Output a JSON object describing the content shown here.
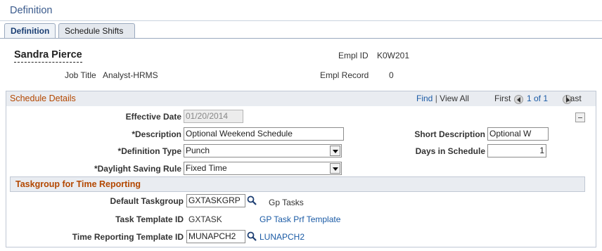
{
  "page": {
    "title": "Definition"
  },
  "tabs": [
    {
      "label": "Definition",
      "active": true
    },
    {
      "label": "Schedule Shifts",
      "active": false
    }
  ],
  "employee": {
    "name": "Sandra Pierce",
    "empl_id_label": "Empl ID",
    "empl_id": "K0W201",
    "job_title_label": "Job Title",
    "job_title": "Analyst-HRMS",
    "empl_record_label": "Empl Record",
    "empl_record": "0"
  },
  "schedule_details": {
    "title": "Schedule Details",
    "find_label": "Find",
    "separator": "|",
    "view_all_label": "View All",
    "first_label": "First",
    "counter": "1 of 1",
    "last_label": "Last",
    "fields": {
      "effective_date": {
        "label": "Effective Date",
        "value": "01/20/2014"
      },
      "description": {
        "label": "*Description",
        "value": "Optional Weekend Schedule"
      },
      "short_description": {
        "label": "Short Description",
        "value": "Optional W"
      },
      "definition_type": {
        "label": "*Definition Type",
        "value": "Punch"
      },
      "days_in_schedule": {
        "label": "Days in Schedule",
        "value": "1"
      },
      "daylight_saving_rule": {
        "label": "*Daylight Saving Rule",
        "value": "Fixed Time"
      }
    }
  },
  "taskgroup": {
    "title": "Taskgroup for Time Reporting",
    "default_taskgroup": {
      "label": "Default Taskgroup",
      "value": "GXTASKGRP",
      "description": "Gp Tasks"
    },
    "task_template": {
      "label": "Task Template ID",
      "value": "GXTASK",
      "link": "GP Task Prf Template"
    },
    "time_reporting_template": {
      "label": "Time Reporting Template ID",
      "value": "MUNAPCH2",
      "link": "LUNAPCH2"
    }
  },
  "colors": {
    "title_blue": "#3a5a8c",
    "section_title_orange": "#b34700",
    "link_blue": "#1a5aa5",
    "header_bg": "#e9ecf1"
  },
  "icons": [
    "lookup-icon",
    "prev-arrow-icon",
    "next-arrow-icon",
    "collapse-icon",
    "dropdown-arrow-icon"
  ]
}
